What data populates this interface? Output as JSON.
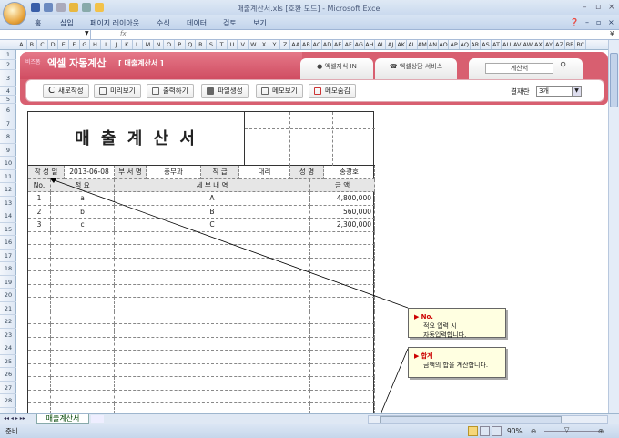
{
  "window": {
    "title": "매출계산서.xls  [호환 모드] - Microsoft Excel"
  },
  "ribbon": {
    "tabs": [
      "홈",
      "삽입",
      "페이지 레이아웃",
      "수식",
      "데이터",
      "검토",
      "보기"
    ]
  },
  "formula_bar": {
    "fx": "fx",
    "name_box": "",
    "value": ""
  },
  "columns": [
    "A",
    "B",
    "C",
    "D",
    "E",
    "F",
    "G",
    "H",
    "I",
    "J",
    "K",
    "L",
    "M",
    "N",
    "O",
    "P",
    "Q",
    "R",
    "S",
    "T",
    "U",
    "V",
    "W",
    "X",
    "Y",
    "Z",
    "AA",
    "AB",
    "AC",
    "AD",
    "AE",
    "AF",
    "AG",
    "AH",
    "AI",
    "AJ",
    "AK",
    "AL",
    "AM",
    "AN",
    "AO",
    "AP",
    "AQ",
    "AR",
    "AS",
    "AT",
    "AU",
    "AV",
    "AW",
    "AX",
    "AY",
    "AZ",
    "BB",
    "BC"
  ],
  "banner": {
    "brand": "비즈폼",
    "app": "엑셀 자동계산",
    "sub": "[ 매출계산서 ]",
    "tab1": "엑셀지식 IN",
    "tab2": "엑셀상담 서비스",
    "search_value": "계산서",
    "buttons": [
      "새로작성",
      "미리보기",
      "출력하기",
      "파일생성",
      "메모보기",
      "메모숨김"
    ],
    "approval_label": "결재란",
    "approval_value": "3개"
  },
  "form": {
    "title": "매 출 계 산 서",
    "info": {
      "date_label": "작 성 일",
      "date": "2013-06-08",
      "dept_label": "부 서 명",
      "dept": "총무과",
      "rank_label": "직   급",
      "rank": "대리",
      "name_label": "성   명",
      "name": "송광호"
    },
    "headers": {
      "no": "No.",
      "summary": "적          요",
      "detail": "세       부       내       역",
      "amount": "금       액"
    },
    "rows": [
      {
        "no": "1",
        "summary": "a",
        "detail": "A",
        "amount": "4,800,000"
      },
      {
        "no": "2",
        "summary": "b",
        "detail": "B",
        "amount": "560,000"
      },
      {
        "no": "3",
        "summary": "c",
        "detail": "C",
        "amount": "2,300,000"
      }
    ]
  },
  "comments": [
    {
      "title": "No.",
      "text1": "적요 입력 시",
      "text2": "자동입력합니다."
    },
    {
      "title": "합계",
      "text1": "금액의 합을 계산합니다."
    }
  ],
  "sheet_tab": "매출계산서",
  "status": {
    "ready": "준비",
    "zoom": "90%"
  }
}
